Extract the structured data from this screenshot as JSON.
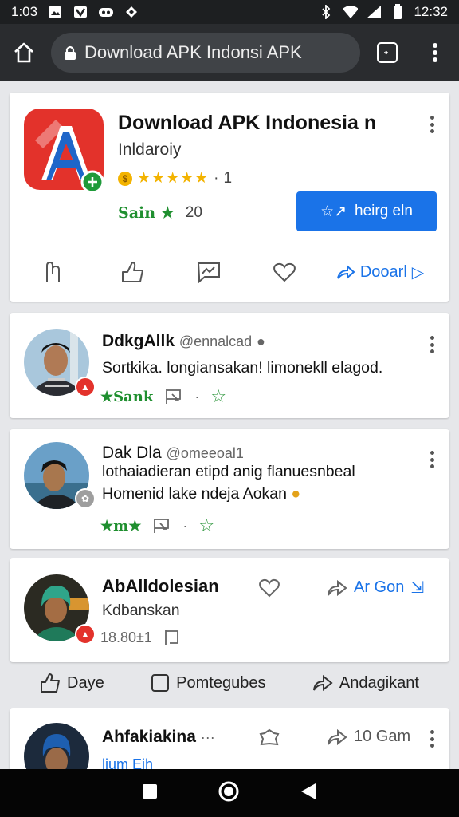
{
  "status_bar": {
    "time": "1:03",
    "clock": "12:32"
  },
  "browser": {
    "url_text": "Download APK Indonsi APK"
  },
  "app": {
    "title": "Download APK Indonesia n",
    "developer": "Inldaroiy",
    "rating_count": "1",
    "badge_text": "Sain",
    "badge_count": "20",
    "install_label": "heirg eln",
    "share_label": "Dooarl",
    "accent": "#1a73e8",
    "green": "#1f8f2f",
    "star_color": "#f3b300"
  },
  "comments": [
    {
      "name": "DdkgAllk",
      "handle": "@ennalcad",
      "text_line1": "Sortkika. longiansakan! limonekll elagod.",
      "text_line2": "",
      "meta_label": "Sank"
    },
    {
      "name": "Dak Dla",
      "handle": "@omeeoal1",
      "text_line1": "lothaiadieran etipd anig flanuesnbeal",
      "text_line2": "Homenid lake ndeja Aokan",
      "meta_label": "m"
    },
    {
      "name": "AbAlldolesian",
      "subtitle": "Kdbanskan",
      "meta": "18.80±1",
      "share_label": "Ar Gon"
    }
  ],
  "bottom_actions": {
    "like": "Daye",
    "comment": "Pomtegubes",
    "share": "Andagikant"
  },
  "last_comment": {
    "name": "Ahfakiakina",
    "time": "10 Gam",
    "partial": "lium Eih"
  }
}
